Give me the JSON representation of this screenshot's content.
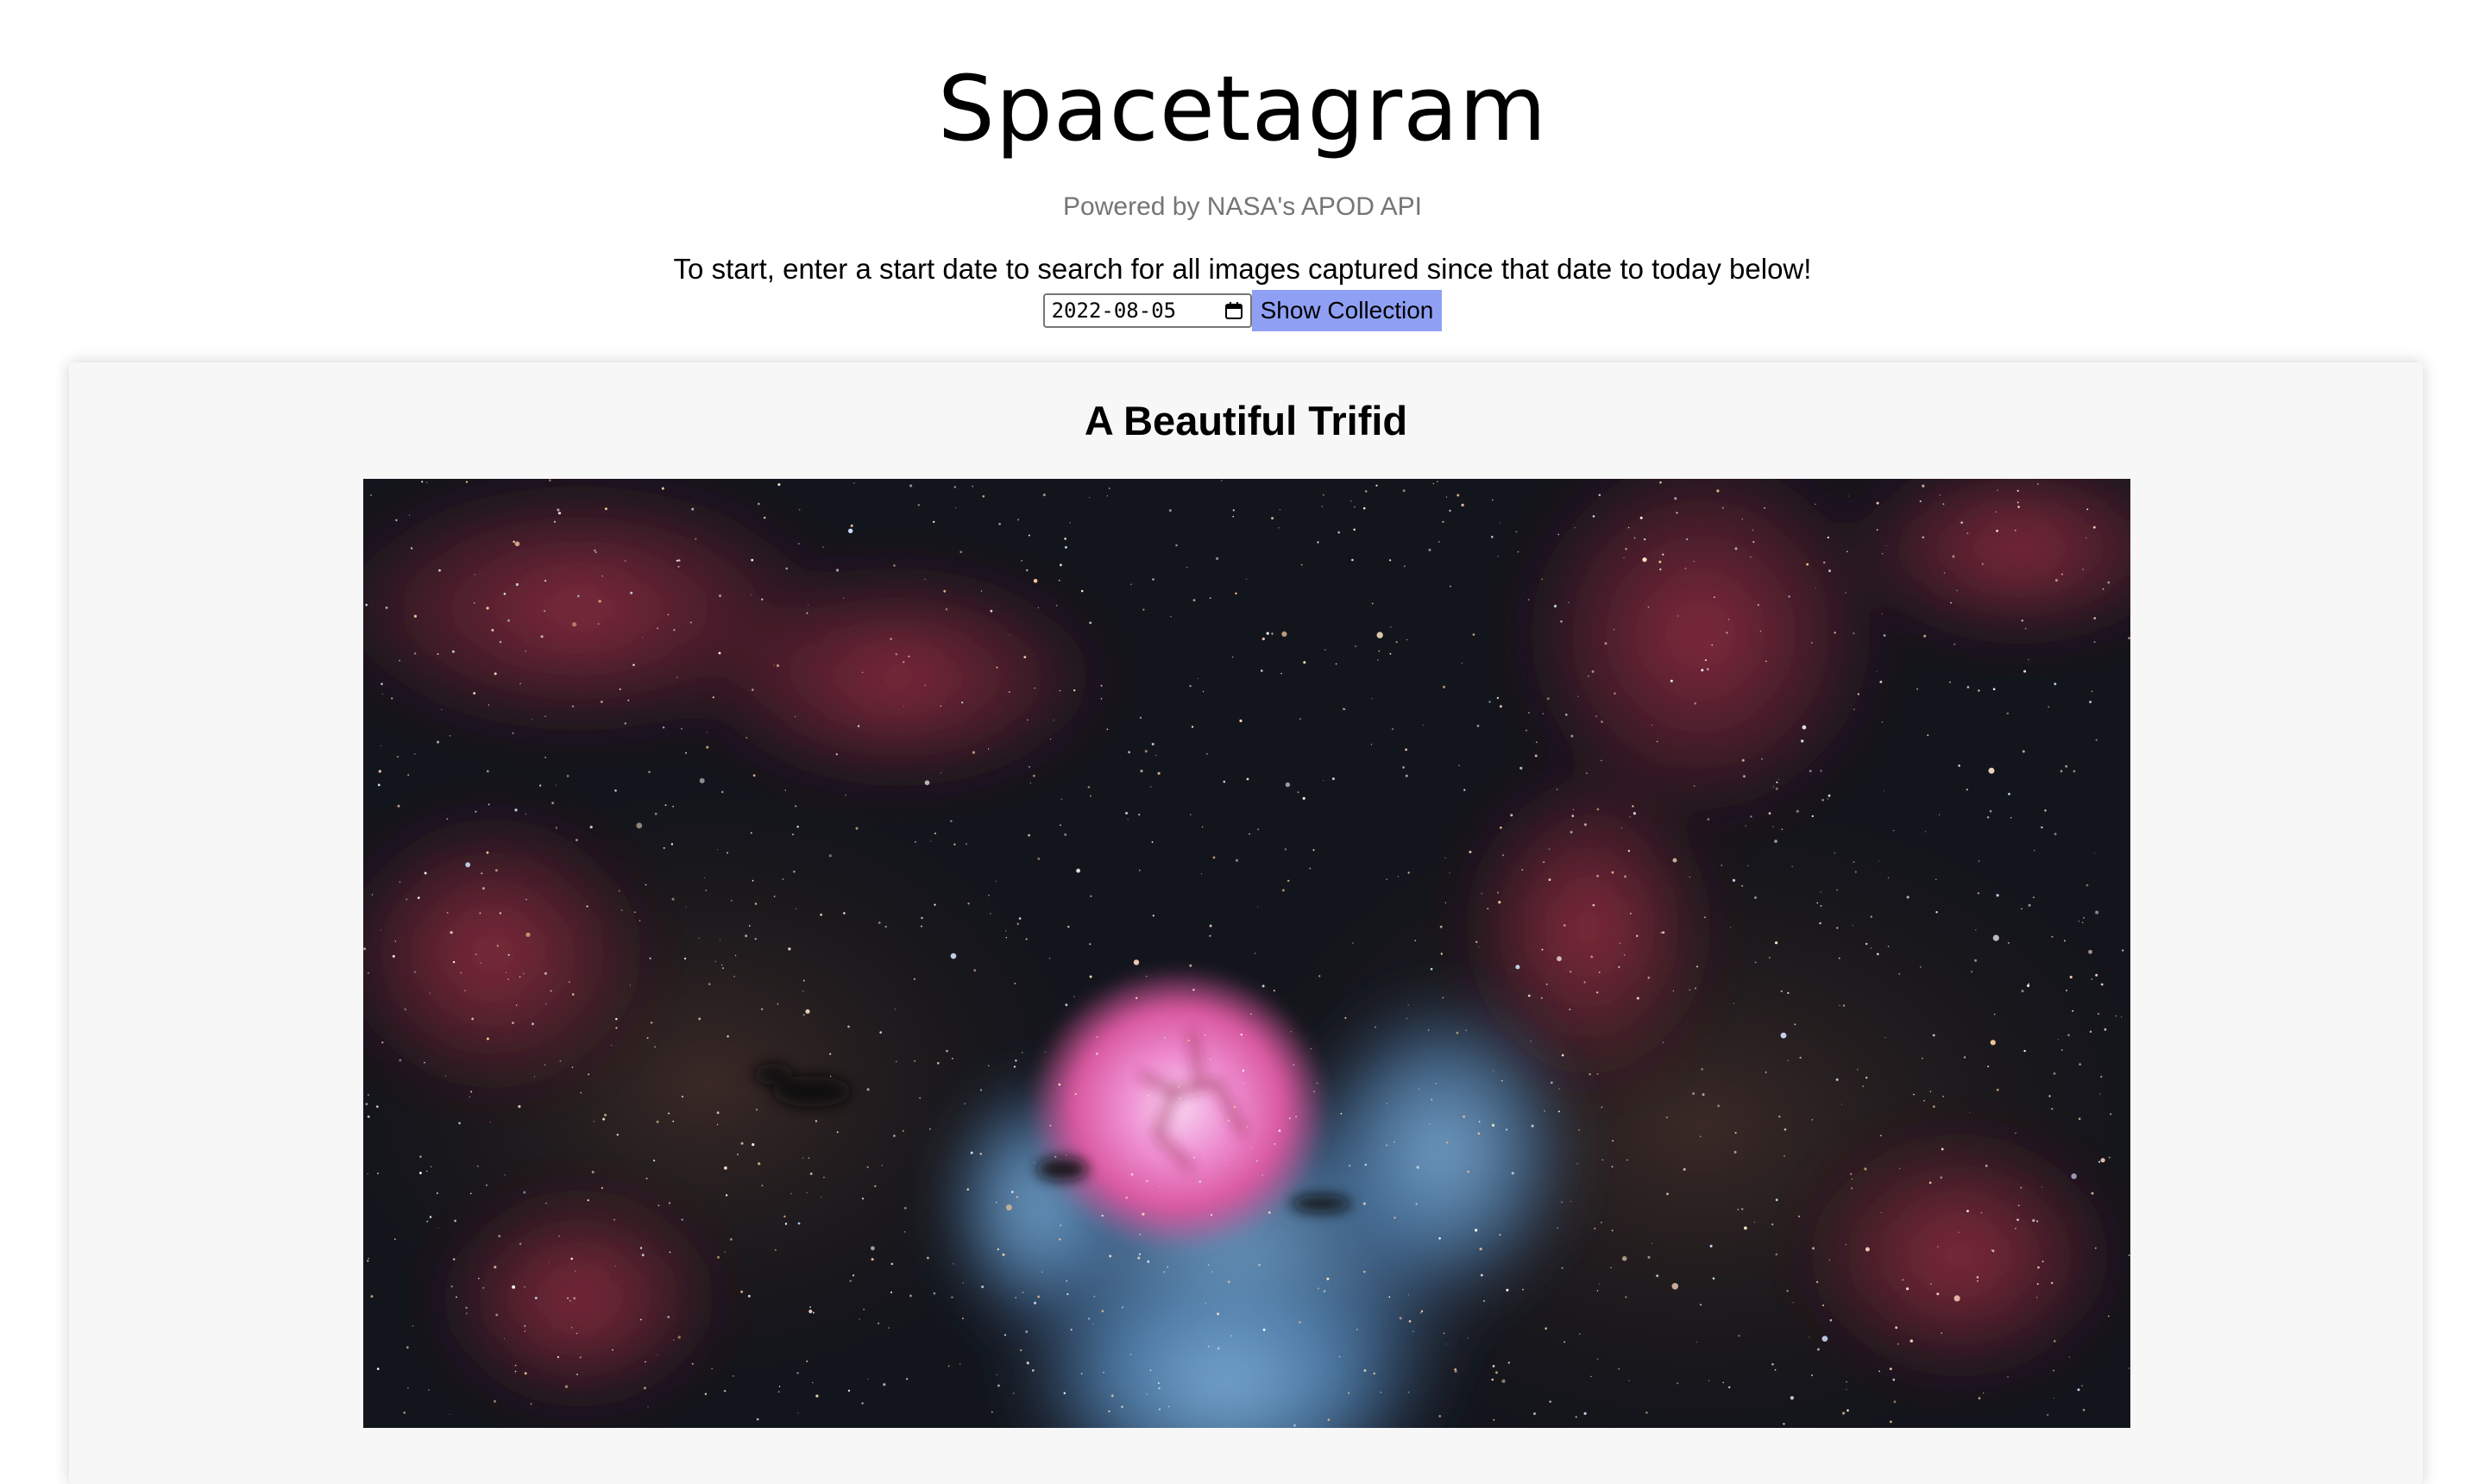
{
  "header": {
    "title": "Spacetagram",
    "subtitle": "Powered by NASA's APOD API",
    "instructions": "To start, enter a start date to search for all images captured since that date to today below!"
  },
  "controls": {
    "start_date": "2022-08-05",
    "show_button_label": "Show Collection",
    "calendar_icon": "calendar-icon",
    "button_color": "#8fa0f4"
  },
  "feed": {
    "posts": [
      {
        "title": "A Beautiful Trifid",
        "image_subject": "trifid-nebula-photo"
      }
    ]
  },
  "colors": {
    "card_background": "#f7f7f7",
    "subtitle_text": "#757575"
  }
}
